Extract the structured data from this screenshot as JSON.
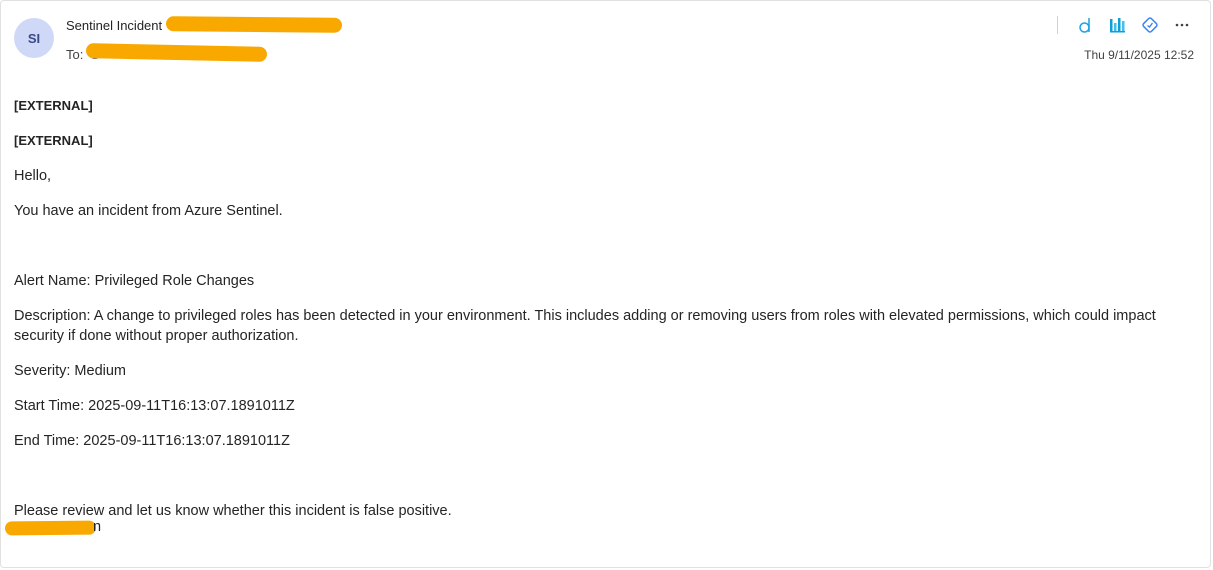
{
  "header": {
    "avatar_initials": "SI",
    "from_label": "Sentinel Incident",
    "to_label": "To:",
    "date": "Thu 9/11/2025 12:52"
  },
  "toolbar": {
    "icons": [
      "app-d-icon",
      "bar-chart-icon",
      "diamond-icon",
      "more-icon"
    ],
    "more_label": "···"
  },
  "body": {
    "external_1": "[EXTERNAL]",
    "external_2": "[EXTERNAL]",
    "greeting": "Hello,",
    "intro": "You have an incident from Azure Sentinel.",
    "alert_name": "Alert Name: Privileged Role Changes",
    "description": "Description: A change to privileged roles has been detected in your environment. This includes adding or removing users from roles with elevated permissions, which could impact security if done without proper authorization.",
    "severity": "Severity: Medium",
    "start_time": "Start Time: 2025-09-11T16:13:07.1891011Z",
    "end_time": "End Time: 2025-09-11T16:13:07.1891011Z",
    "request": "Please review and let us know whether this incident is false positive.",
    "signature_tail": "n"
  },
  "colors": {
    "redaction": "#f9a800",
    "avatar_bg": "#cfd8f7",
    "accent": "#1ba1e2"
  }
}
